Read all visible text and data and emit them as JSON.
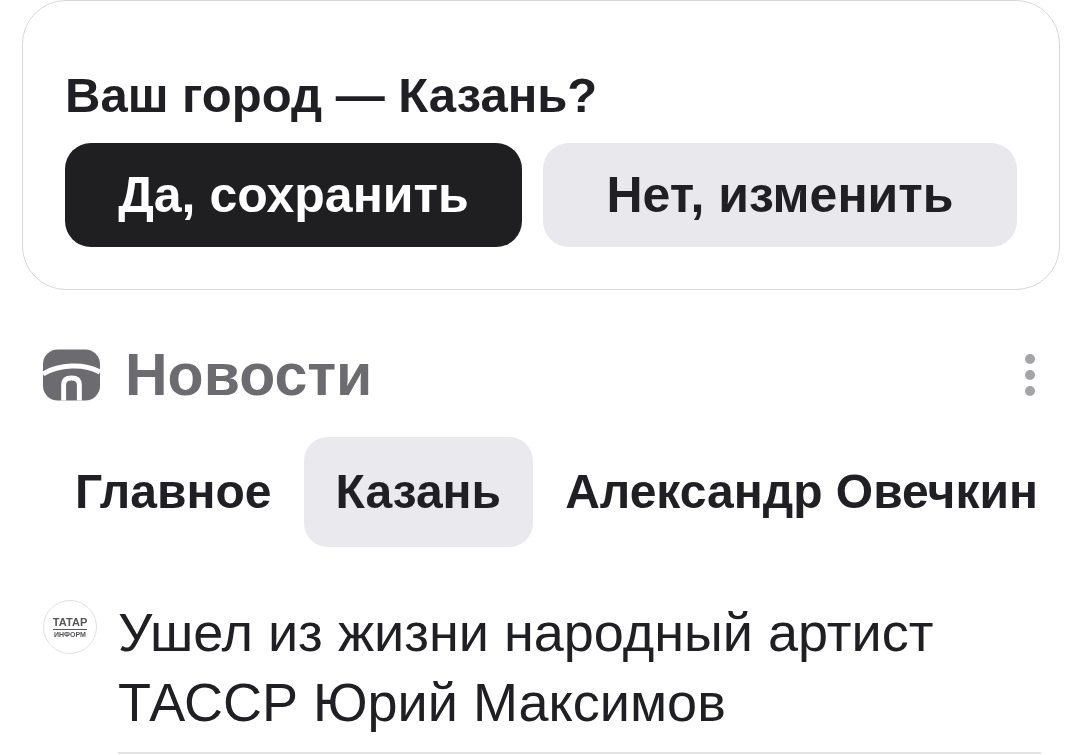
{
  "city_prompt": {
    "title": "Ваш город — Казань?",
    "buttons": [
      {
        "label": "Да, сохранить",
        "kind": "primary"
      },
      {
        "label": "Нет, изменить",
        "kind": "secondary"
      }
    ]
  },
  "news": {
    "title": "Новости",
    "tabs": [
      {
        "label": "Главное",
        "selected": false
      },
      {
        "label": "Казань",
        "selected": true
      },
      {
        "label": "Александр Овечкин",
        "selected": false
      }
    ],
    "items": [
      {
        "source_logo": [
          "ТАТАР",
          "ИНФОРМ"
        ],
        "headline": "Ушел из жизни народный артист ТАССР Юрий Максимов"
      }
    ]
  }
}
